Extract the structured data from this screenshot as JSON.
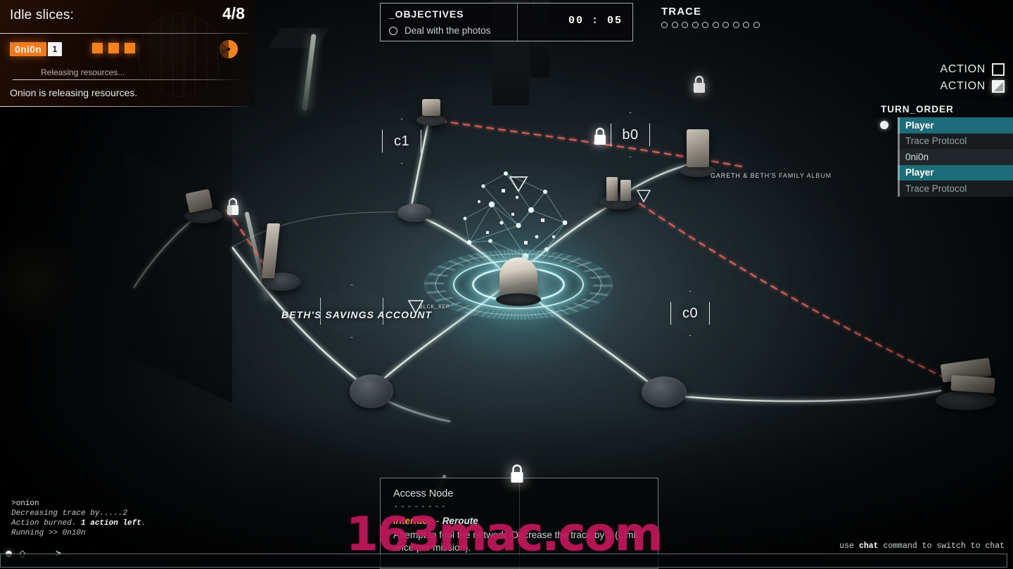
{
  "idle_panel": {
    "label": "Idle slices:",
    "value": "4/8",
    "agent_name": "0ni0n",
    "agent_count": "1",
    "pip_count": 3,
    "status_sub": "Releasing resources...",
    "status_main": "Onion is releasing resources.",
    "accent_color": "#f5821f"
  },
  "objectives": {
    "title": "_OBJECTIVES",
    "timer": "00 : 05",
    "items": [
      {
        "text": "Deal with the photos",
        "done": false
      }
    ]
  },
  "trace": {
    "title": "TRACE",
    "total": 10,
    "filled": 0
  },
  "actions": [
    {
      "label": "ACTION",
      "used": false
    },
    {
      "label": "ACTION",
      "used": true
    }
  ],
  "turn_order": {
    "title": "TURN_ORDER",
    "rows": [
      {
        "name": "Player",
        "state": "active",
        "marker": true
      },
      {
        "name": "Trace Protocol",
        "state": "idle",
        "marker": false
      },
      {
        "name": "0ni0n",
        "state": "self",
        "marker": false
      },
      {
        "name": "Player",
        "state": "active",
        "marker": false
      },
      {
        "name": "Trace Protocol",
        "state": "idle",
        "marker": false
      }
    ],
    "active_color": "#1d6c79"
  },
  "board": {
    "hex_nodes": [
      {
        "id": "c1",
        "label": "c1"
      },
      {
        "id": "b0",
        "label": "b0"
      },
      {
        "id": "c0",
        "label": "c0"
      }
    ],
    "labels": [
      {
        "id": "beths-savings",
        "text": "BETH'S SAVINGS ACCOUNT"
      },
      {
        "id": "gareth-album",
        "text": "GARETH & BETH'S FAMILY ALBUM"
      },
      {
        "id": "blck-rep",
        "text": "BLCK_REP"
      }
    ],
    "lock_count": 4
  },
  "tooltip": {
    "title": "Access Node",
    "dashes": "--------",
    "kind": "Interface",
    "separator": "-",
    "ability": "Reroute",
    "description": "Attempt to fool the network. Decrease the trace by 3 (Limit once per mission).",
    "kind_color": "#e8a33a"
  },
  "console": {
    "lines": [
      {
        "text": ">onion",
        "type": "cmd"
      },
      {
        "text": "Decreasing trace by.....2",
        "type": "log"
      },
      {
        "text": "Action burned. 1 action left.",
        "type": "log",
        "bold": "1 action left"
      },
      {
        "text": "Running >> 0ni0n",
        "type": "log"
      }
    ],
    "prompt": ">"
  },
  "chat_hint": {
    "prefix": "use ",
    "command": "chat",
    "suffix": " command to switch to chat"
  },
  "watermark": {
    "text": "163mac.com",
    "color": "#c2185b"
  }
}
